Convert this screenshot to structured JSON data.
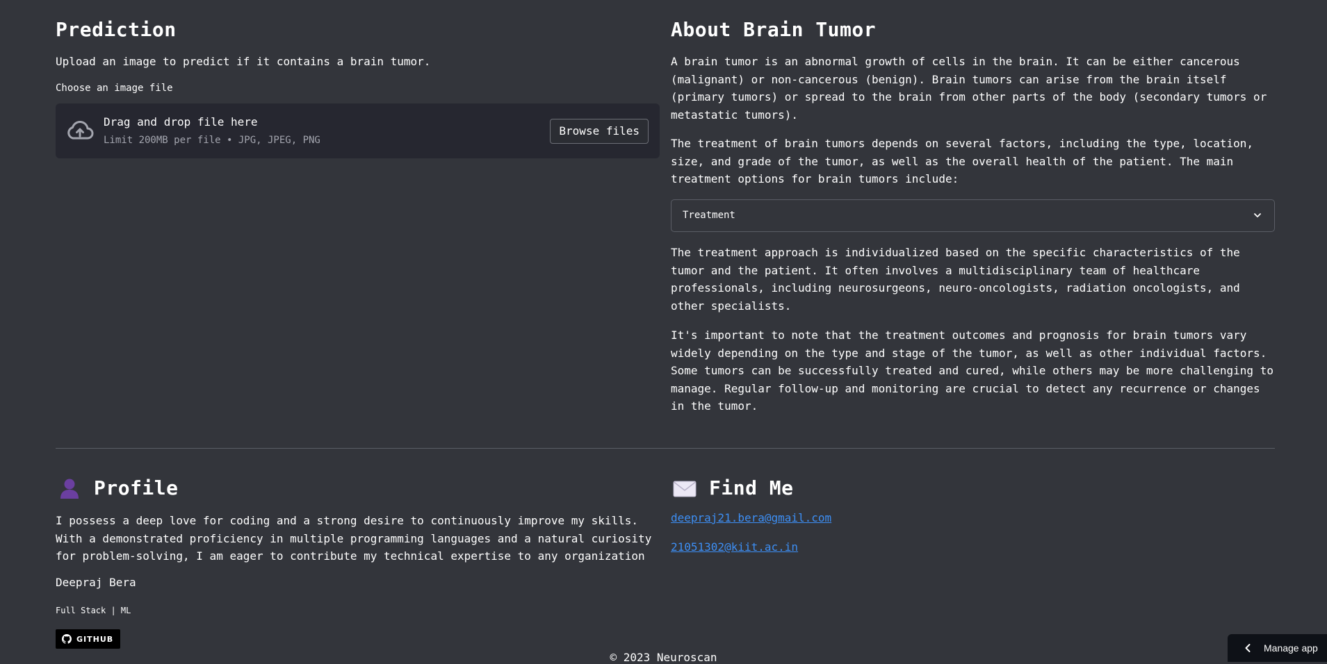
{
  "prediction": {
    "heading": "Prediction",
    "lead": "Upload an image to predict if it contains a brain tumor.",
    "uploader_label": "Choose an image file",
    "dropzone_title": "Drag and drop file here",
    "dropzone_limit": "Limit 200MB per file • JPG, JPEG, PNG",
    "browse_label": "Browse files"
  },
  "about": {
    "heading": "About Brain Tumor",
    "p1": "A brain tumor is an abnormal growth of cells in the brain. It can be either cancerous (malignant) or non-cancerous (benign). Brain tumors can arise from the brain itself (primary tumors) or spread to the brain from other parts of the body (secondary tumors or metastatic tumors).",
    "p2": "The treatment of brain tumors depends on several factors, including the type, location, size, and grade of the tumor, as well as the overall health of the patient. The main treatment options for brain tumors include:",
    "expander_label": "Treatment",
    "p3": "The treatment approach is individualized based on the specific characteristics of the tumor and the patient. It often involves a multidisciplinary team of healthcare professionals, including neurosurgeons, neuro-oncologists, radiation oncologists, and other specialists.",
    "p4": "It's important to note that the treatment outcomes and prognosis for brain tumors vary widely depending on the type and stage of the tumor, as well as other individual factors. Some tumors can be successfully treated and cured, while others may be more challenging to manage. Regular follow-up and monitoring are crucial to detect any recurrence or changes in the tumor."
  },
  "profile": {
    "heading": "Profile",
    "icon": "person-silhouette-icon",
    "text": "I possess a deep love for coding and a strong desire to continuously improve my skills. With a demonstrated proficiency in multiple programming languages and a natural curiosity for problem-solving, I am eager to contribute my technical expertise to any organization",
    "name": "Deepraj Bera",
    "role": "Full Stack | ML",
    "github_label": "GITHUB"
  },
  "find_me": {
    "heading": "Find Me",
    "icon": "envelope-icon",
    "emails": [
      "deepraj21.bera@gmail.com",
      "21051302@kiit.ac.in"
    ]
  },
  "footer": {
    "copyright": "© 2023 Neuroscan"
  },
  "manage_app": {
    "label": "Manage app"
  },
  "colors": {
    "background": "#33353b",
    "dropzone": "#262730",
    "link": "#3d8ff5",
    "divider": "#5b5e66"
  }
}
